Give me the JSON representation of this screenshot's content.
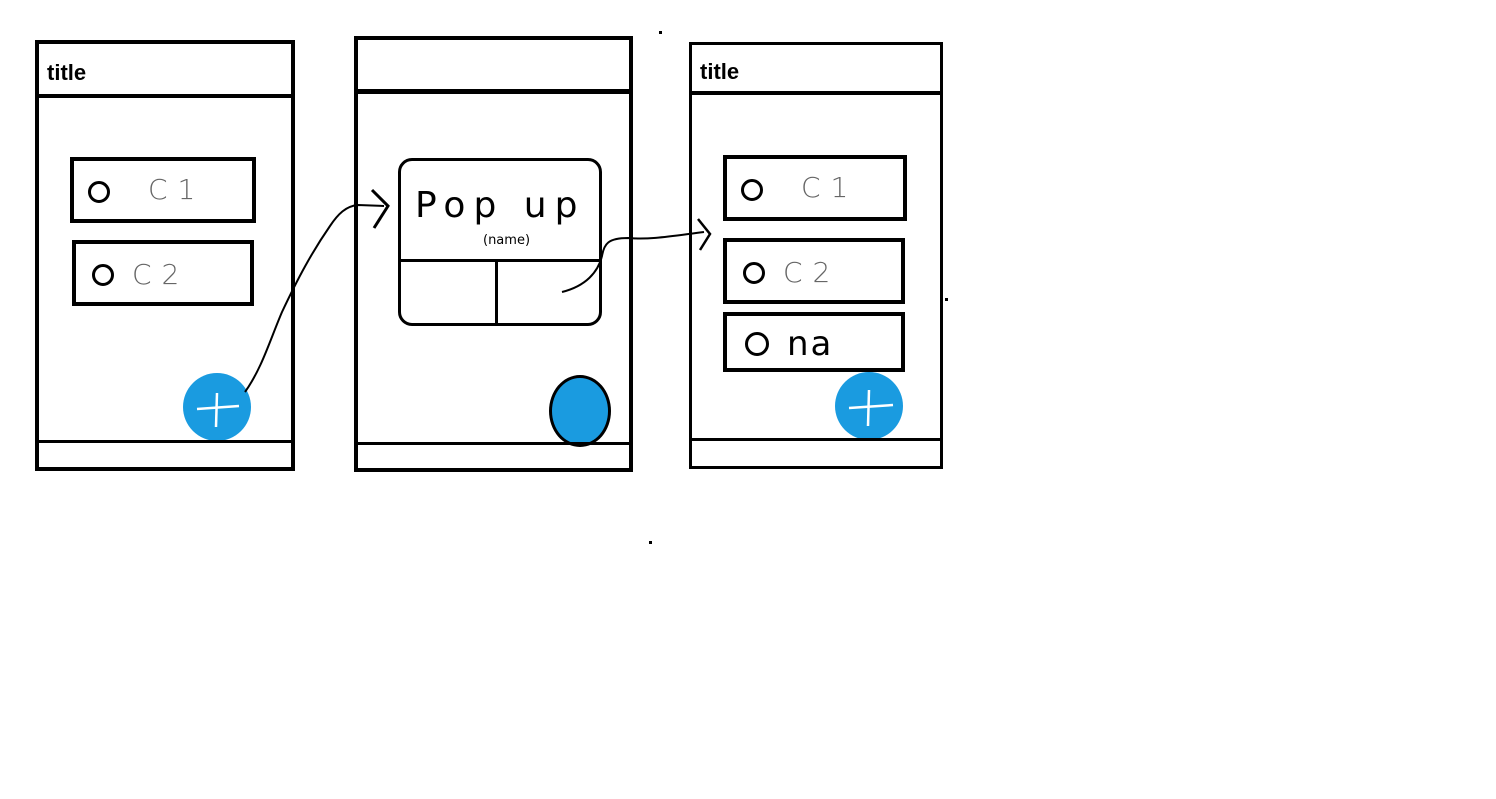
{
  "screens": [
    {
      "title": "title",
      "items": [
        {
          "label": "C1"
        },
        {
          "label": "C2"
        }
      ],
      "fab_icon": "plus-icon"
    },
    {
      "popup": {
        "title": "Pop up",
        "subtitle": "(name)"
      },
      "fab_icon": "circle-icon"
    },
    {
      "title": "title",
      "items": [
        {
          "label": "C1"
        },
        {
          "label": "C2"
        },
        {
          "label": "na"
        }
      ],
      "fab_icon": "plus-icon"
    }
  ],
  "colors": {
    "fab": "#1a9be0",
    "stroke": "#000000",
    "background": "#ffffff"
  }
}
